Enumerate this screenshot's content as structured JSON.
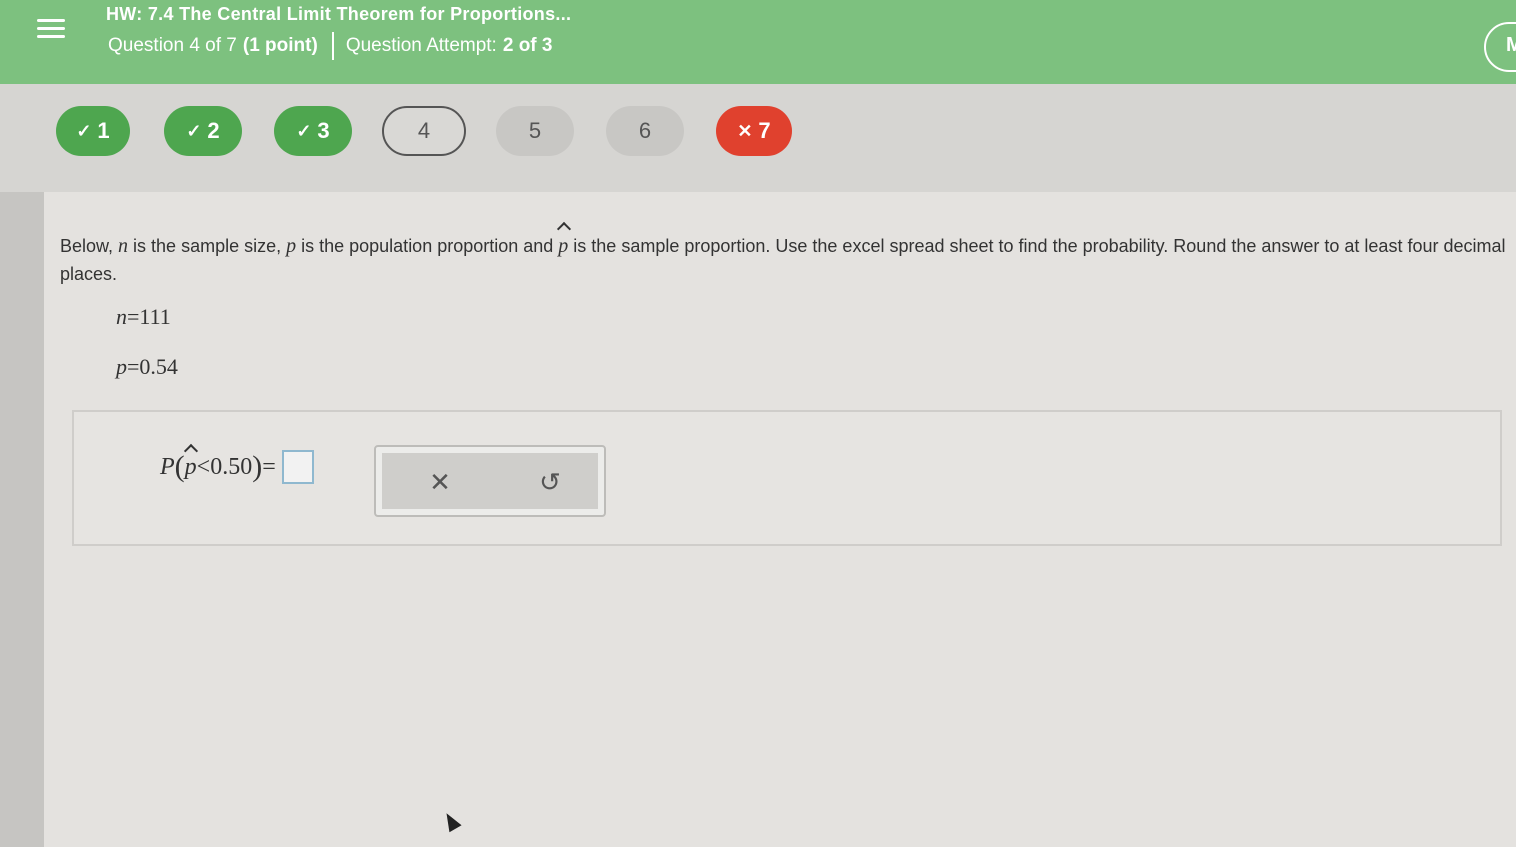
{
  "header": {
    "title": "HW: 7.4 The Central Limit Theorem for Proportions...",
    "question_position": "Question 4 of 7",
    "points": "(1 point)",
    "attempt_label": "Question Attempt:",
    "attempt_value": "2 of 3",
    "avatar_initial": "M",
    "menu_icon": "hamburger-menu-icon"
  },
  "question_nav": [
    {
      "number": "1",
      "status": "correct",
      "mark": "✓"
    },
    {
      "number": "2",
      "status": "correct",
      "mark": "✓"
    },
    {
      "number": "3",
      "status": "correct",
      "mark": "✓"
    },
    {
      "number": "4",
      "status": "current",
      "mark": ""
    },
    {
      "number": "5",
      "status": "pending",
      "mark": ""
    },
    {
      "number": "6",
      "status": "pending",
      "mark": ""
    },
    {
      "number": "7",
      "status": "incorrect",
      "mark": "✕"
    }
  ],
  "question": {
    "part1": "Below, ",
    "var_n": "n",
    "part2": " is the sample size, ",
    "var_p": "p",
    "part3": " is the population proportion and ",
    "var_phat": "p",
    "part4": " is the sample proportion. Use the excel spread sheet to find the probability. Round the answer to at least four decimal places.",
    "given": [
      {
        "var": "n",
        "value": "=111"
      },
      {
        "var": "p",
        "value": "=0.54"
      }
    ]
  },
  "answer": {
    "prob_P": "P",
    "open_paren": "(",
    "var_phat": "p",
    "relation": "<0.50",
    "close_paren": ")",
    "equals": "=",
    "input_value": "",
    "clear_symbol": "✕",
    "undo_symbol": "↺"
  },
  "colors": {
    "header_green": "#7dc17f",
    "correct_green": "#4ea64f",
    "incorrect_red": "#e0412e"
  }
}
